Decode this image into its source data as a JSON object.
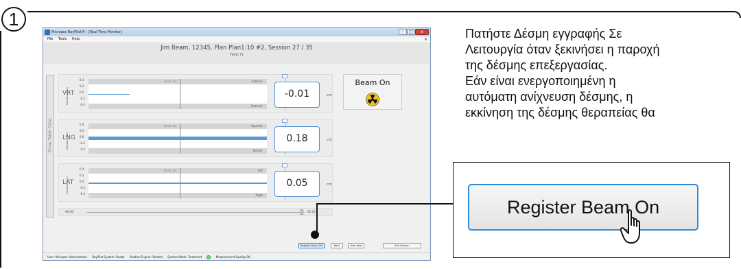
{
  "step": {
    "number": "1"
  },
  "instruction": {
    "lines": [
      "Πατήστε Δέσμη εγγραφής Σε",
      "Λειτουργία όταν ξεκινήσει η παροχή",
      "της δέσμης επεξεργασίας.",
      "Εάν είναι ενεργοποιημένη η",
      "αυτόματη ανίχνευση δέσμης, η",
      "εκκίνηση της δέσμης θεραπείας θα"
    ]
  },
  "app": {
    "window_title": "Micropos RayPilot® - [Real-Time Monitor]",
    "menu": {
      "file": "File",
      "tools": "Tools",
      "help": "Help",
      "close": "×"
    },
    "session_title": "Jim Beam, 12345, Plan Plan1:10 #2, Session 27 / 35",
    "field_label": "Field: f1",
    "side_tab_label": "Show Table Data",
    "y_axis_label": "Deviation (cm)",
    "ticks": [
      "0.4",
      "0.2",
      "0.0",
      "-0.2",
      "-0.4"
    ],
    "beam_tag": "Beam On",
    "unit": "cm",
    "panels": [
      {
        "axis": "VRT",
        "dir_top": "Anterior",
        "dir_bottom": "Posterior",
        "value": "-0.01"
      },
      {
        "axis": "LNG",
        "dir_top": "Superior",
        "dir_bottom": "Inferior",
        "value": "0.18"
      },
      {
        "axis": "LAT",
        "dir_top": "Left",
        "dir_bottom": "Right",
        "value": "0.05"
      }
    ],
    "beam_status": {
      "label": "Beam On",
      "icon": "radiation-icon"
    },
    "time": {
      "start": "-00:30",
      "end": "02:21"
    },
    "buttons": {
      "register_beam_off": "Register Beam Off",
      "back": "Back",
      "new_field": "New field",
      "end_session": "End Session"
    },
    "status": {
      "user": "User: Micropos Administrator",
      "system": "RayPilot System: Ready",
      "engine": "Position Engine: Started",
      "mode": "System Mode: Treatment",
      "quality": "Measurement Quality OK"
    }
  },
  "zoom": {
    "button_label": "Register Beam On",
    "cursor": "hand-cursor-icon"
  }
}
